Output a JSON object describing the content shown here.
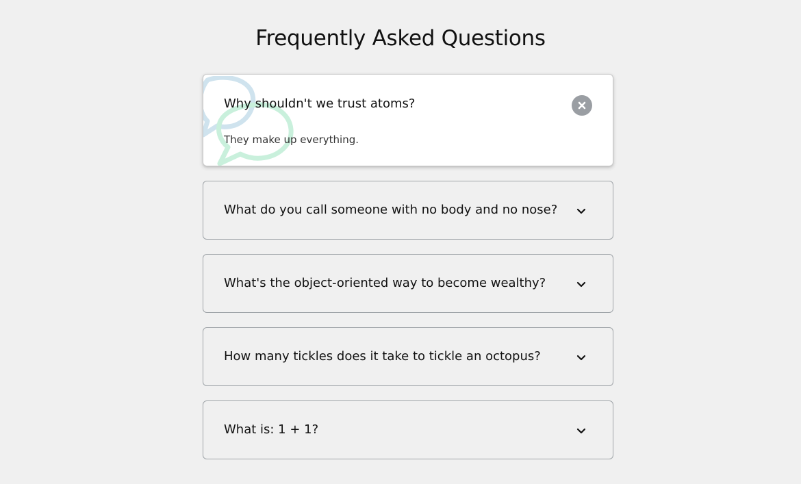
{
  "page": {
    "title": "Frequently Asked Questions"
  },
  "faqs": [
    {
      "question": "Why shouldn't we trust atoms?",
      "answer": "They make up everything.",
      "state": "open",
      "toggle_icon": "close-icon"
    },
    {
      "question": "What do you call someone with no body and no nose?",
      "state": "closed",
      "toggle_icon": "chevron-down-icon"
    },
    {
      "question": "What's the object-oriented way to become wealthy?",
      "state": "closed",
      "toggle_icon": "chevron-down-icon"
    },
    {
      "question": "How many tickles does it take to tickle an octopus?",
      "state": "closed",
      "toggle_icon": "chevron-down-icon"
    },
    {
      "question": "What is: 1 + 1?",
      "state": "closed",
      "toggle_icon": "chevron-down-icon"
    }
  ],
  "colors": {
    "background": "#f0f0f0",
    "active_card": "#ffffff",
    "border": "#9fa4a8",
    "close_button": "#9a9ea3",
    "bubble_blue": "#cfe3ee",
    "bubble_green": "#c9f0dc"
  }
}
